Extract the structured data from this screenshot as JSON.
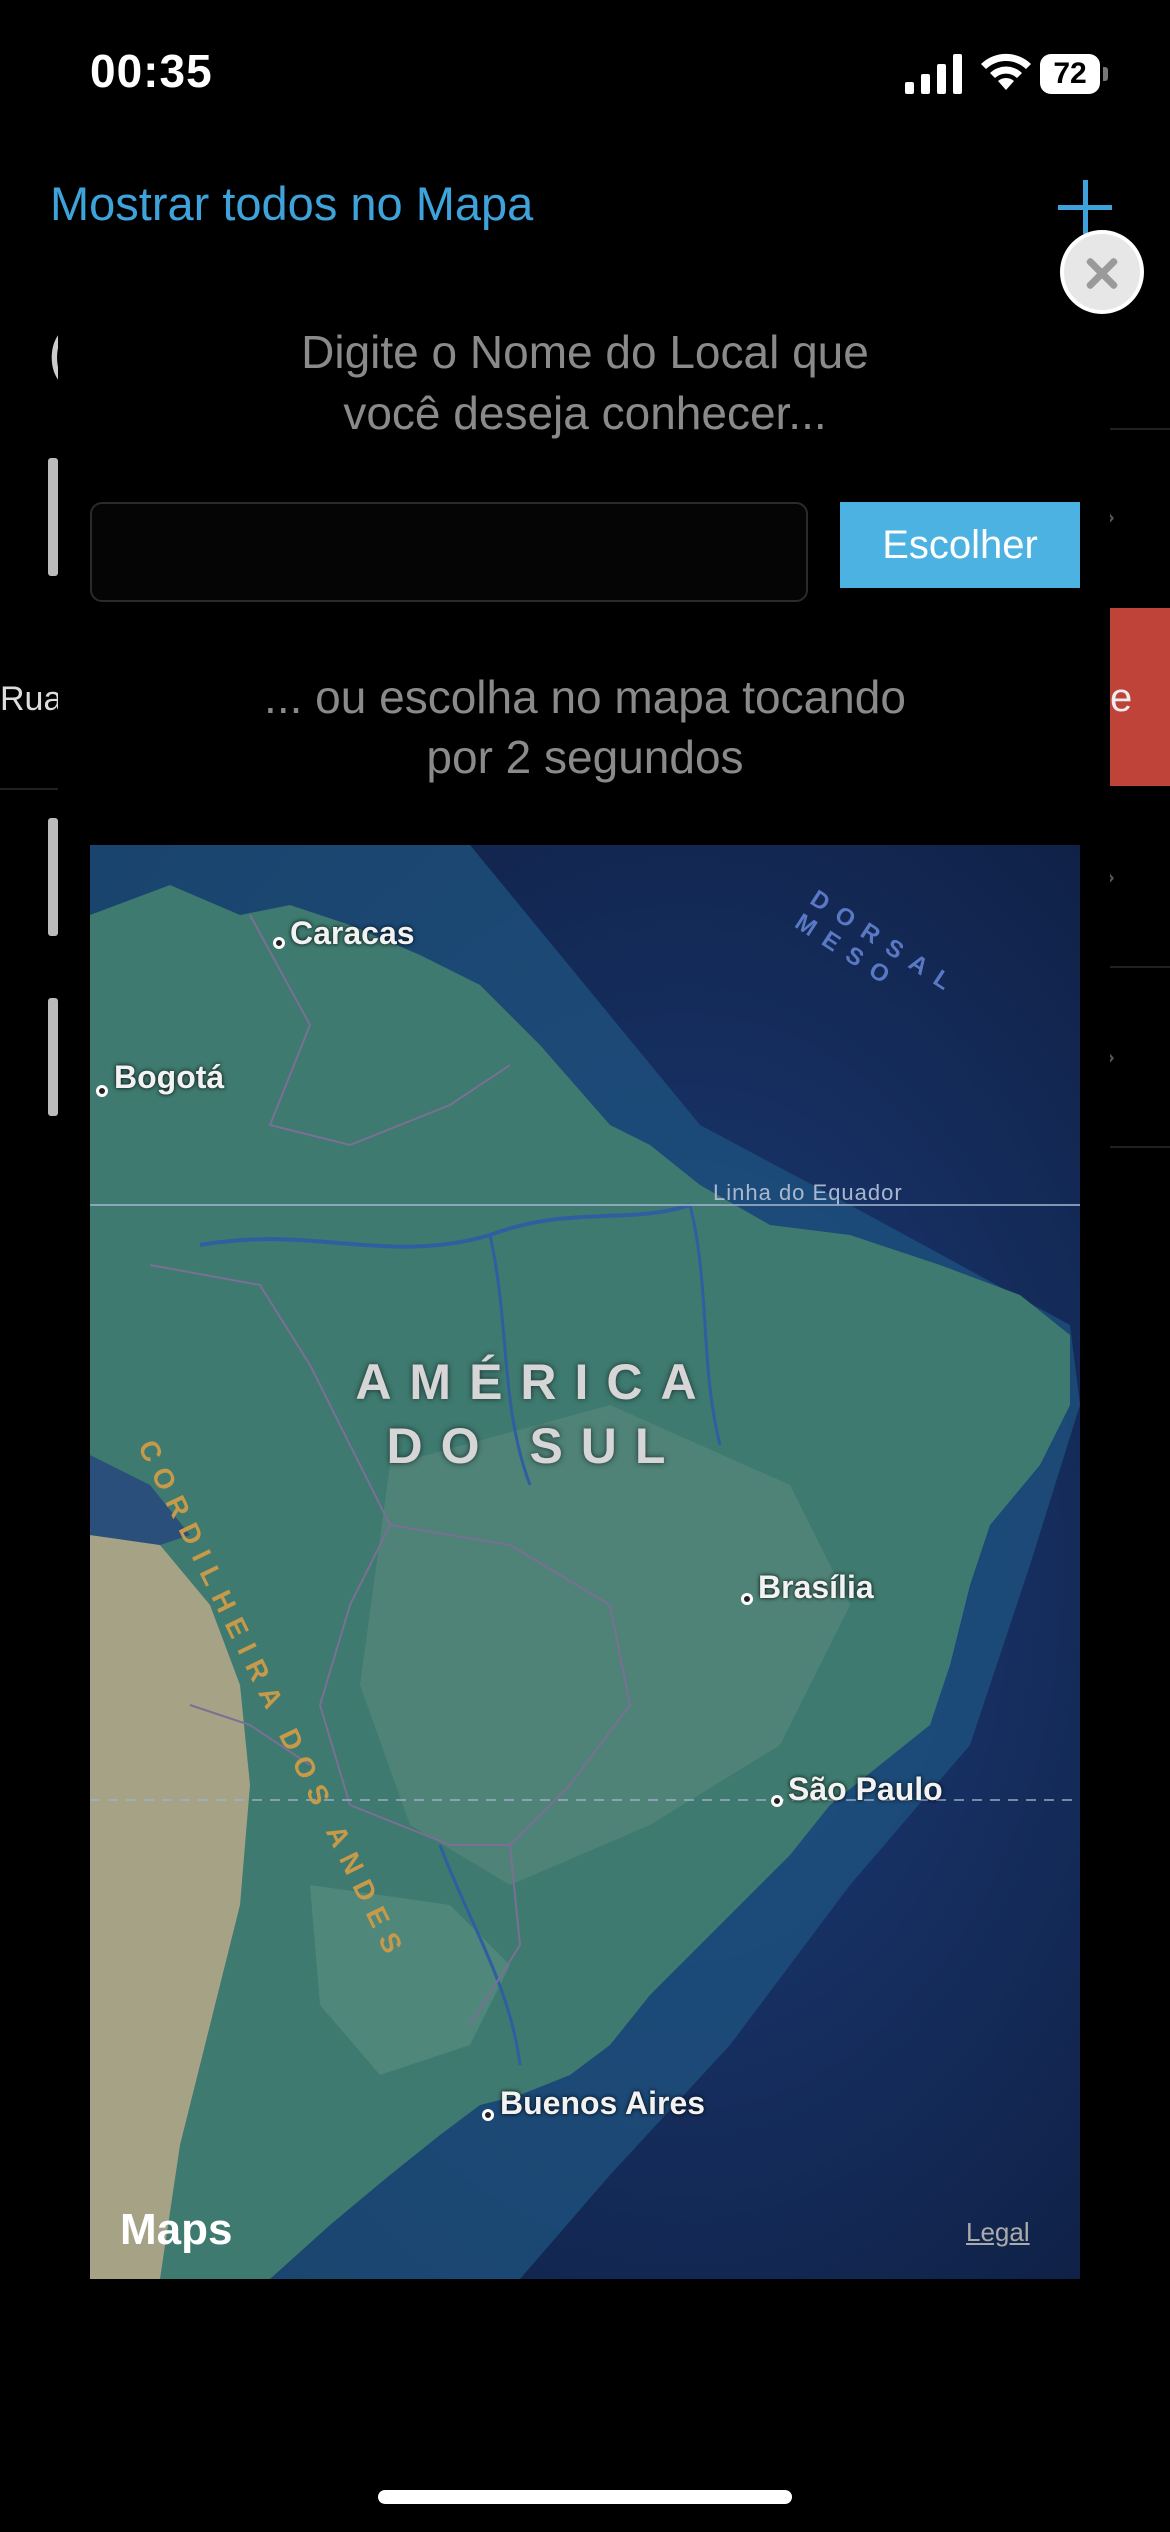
{
  "status_bar": {
    "time": "00:35",
    "battery": "72"
  },
  "nav": {
    "show_all_link": "Mostrar todos no Mapa"
  },
  "background": {
    "rua_text": "Rua",
    "red_action_fragment": "e",
    "glyph": "("
  },
  "modal": {
    "prompt_line1": "Digite o Nome do Local que",
    "prompt_line2": "você deseja conhecer...",
    "input_value": "",
    "choose_button": "Escolher",
    "alt_line1": "... ou escolha no mapa tocando",
    "alt_line2": "por 2 segundos"
  },
  "map": {
    "cities": [
      "Caracas",
      "Bogotá",
      "Brasília",
      "São Paulo",
      "Buenos Aires"
    ],
    "continent_line1": "AMÉRICA",
    "continent_line2": "DO SUL",
    "equator_label": "Linha do Equador",
    "ridge_label": "DORSAL MESO",
    "mountain_label": "CORDILHEIRA DOS ANDES",
    "attribution": "Maps",
    "legal_link": "Legal"
  }
}
